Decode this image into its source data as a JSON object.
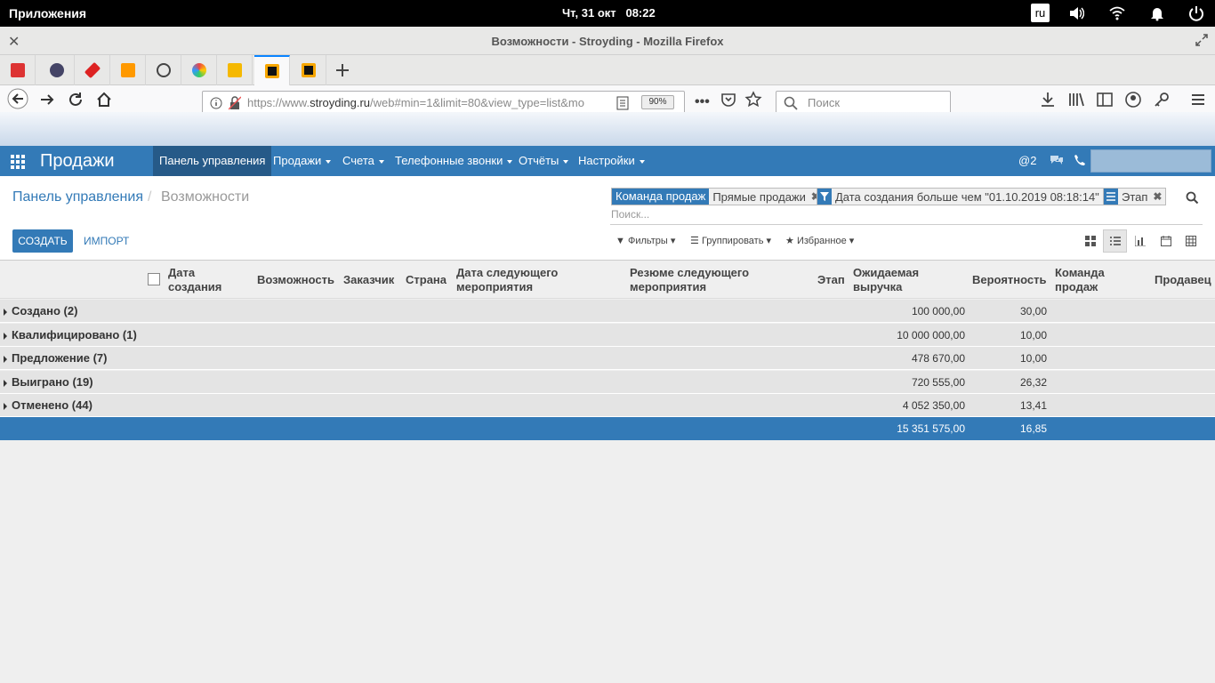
{
  "system": {
    "apps_label": "Приложения",
    "clock": "Чт, 31 окт   08:22",
    "lang": "ru"
  },
  "browser": {
    "window_title": "Возможности - Stroyding - Mozilla Firefox",
    "url_prefix": "https://www.",
    "url_domain": "stroyding.ru",
    "url_rest": "/web#min=1&limit=80&view_type=list&mo",
    "zoom": "90%",
    "search_placeholder": "Поиск"
  },
  "app": {
    "brand": "Продажи",
    "menu": [
      {
        "label": "Панель управления"
      },
      {
        "label": "Продажи"
      },
      {
        "label": "Счета"
      },
      {
        "label": "Телефонные звонки"
      },
      {
        "label": "Отчёты"
      },
      {
        "label": "Настройки"
      }
    ],
    "mentions": "@2"
  },
  "control_panel": {
    "breadcrumb": [
      "Панель управления",
      "/",
      "Возможности"
    ],
    "create_label": "СОЗДАТЬ",
    "import_label": "ИМПОРТ",
    "facets": [
      {
        "label": "Команда продаж",
        "value": "Прямые продажи"
      },
      {
        "value": "Дата создания больше чем \"01.10.2019 08:18:14\""
      },
      {
        "value": "Этап"
      }
    ],
    "search_placeholder": "Поиск...",
    "filters_label": "Фильтры",
    "group_label": "Группировать",
    "favorites_label": "Избранное"
  },
  "table": {
    "columns": [
      "Дата\nсоздания",
      "Возможность",
      "Заказчик",
      "Страна",
      "Дата следующего\nмероприятия",
      "Резюме следующего\nмероприятия",
      "Этап",
      "Ожидаемая\nвыручка",
      "Вероятность",
      "Команда\nпродаж",
      "Продавец"
    ],
    "groups": [
      {
        "name": "Создано (2)",
        "revenue": "100 000,00",
        "probability": "30,00"
      },
      {
        "name": "Квалифицировано (1)",
        "revenue": "10 000 000,00",
        "probability": "10,00"
      },
      {
        "name": "Предложение (7)",
        "revenue": "478 670,00",
        "probability": "10,00"
      },
      {
        "name": "Выиграно (19)",
        "revenue": "720 555,00",
        "probability": "26,32"
      },
      {
        "name": "Отменено (44)",
        "revenue": "4 052 350,00",
        "probability": "13,41"
      }
    ],
    "total": {
      "revenue": "15 351 575,00",
      "probability": "16,85"
    }
  }
}
